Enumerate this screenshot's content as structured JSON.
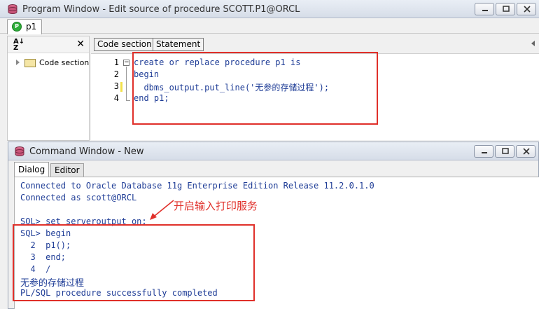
{
  "program_window": {
    "title": "Program Window - Edit source of procedure SCOTT.P1@ORCL",
    "doc_tab": {
      "icon_letter": "P",
      "label": "p1"
    },
    "left_pane": {
      "tree_item": "Code section"
    },
    "toolbar": {
      "code_section_label": "Code section",
      "statement_label": "Statement"
    },
    "editor": {
      "line_numbers": [
        "1",
        "2",
        "3",
        "4"
      ],
      "lines": [
        "create or replace procedure p1 is",
        "begin",
        "  dbms_output.put_line('无参的存储过程');",
        "end p1;"
      ]
    }
  },
  "command_window": {
    "title": "Command Window - New",
    "tabs": [
      "Dialog",
      "Editor"
    ],
    "console_lines": [
      "Connected to Oracle Database 11g Enterprise Edition Release 11.2.0.1.0",
      "Connected as scott@ORCL",
      "",
      "SQL> set serveroutput on;",
      "SQL> begin",
      "  2  p1();",
      "  3  end;",
      "  4  /",
      "无参的存储过程",
      "PL/SQL procedure successfully completed"
    ]
  },
  "annotation": {
    "text": "开启输入打印服务",
    "color": "#e0302a"
  },
  "colors": {
    "highlight": "#e0302a",
    "code_text": "#1e3c96",
    "keyword": "#1a8a8a",
    "tab_icon": "#2eae3a"
  },
  "icons": [
    "database-icon",
    "procedure-icon",
    "sort-az-icon",
    "close-icon",
    "folder-icon",
    "minimize-icon",
    "maximize-icon",
    "close-window-icon"
  ]
}
